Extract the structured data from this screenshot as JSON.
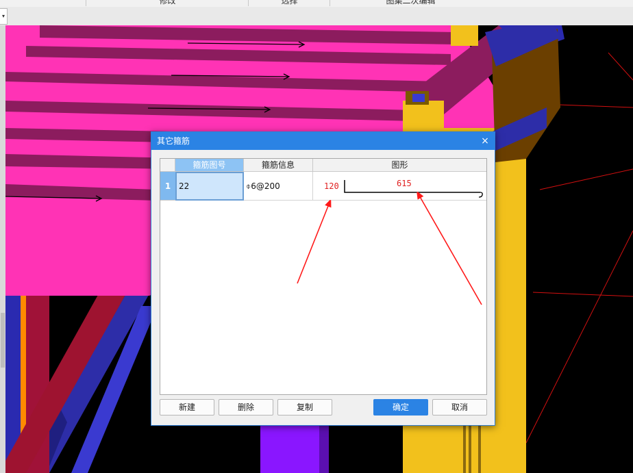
{
  "toolbar": {
    "items": [
      "修改",
      "选择",
      "图集二次编辑"
    ]
  },
  "dialog": {
    "title": "其它箍筋",
    "close_glyph": "×",
    "columns": [
      "箍筋图号",
      "箍筋信息",
      "图形"
    ],
    "rows": [
      {
        "index": "1",
        "figure_no": "22",
        "info": "⌽6@200",
        "shape_left": "120",
        "shape_top": "615"
      }
    ],
    "buttons": {
      "new": "新建",
      "delete": "删除",
      "copy": "复制",
      "ok": "确定",
      "cancel": "取消"
    }
  },
  "colors": {
    "accent": "#2b83e4",
    "annotation": "#ff1a1a",
    "beam_pink": "#ff33b5",
    "beam_maroon": "#8c1c5e",
    "column_yellow": "#f2c11c",
    "blue": "#2d2da8",
    "purple": "#8a16ff"
  }
}
